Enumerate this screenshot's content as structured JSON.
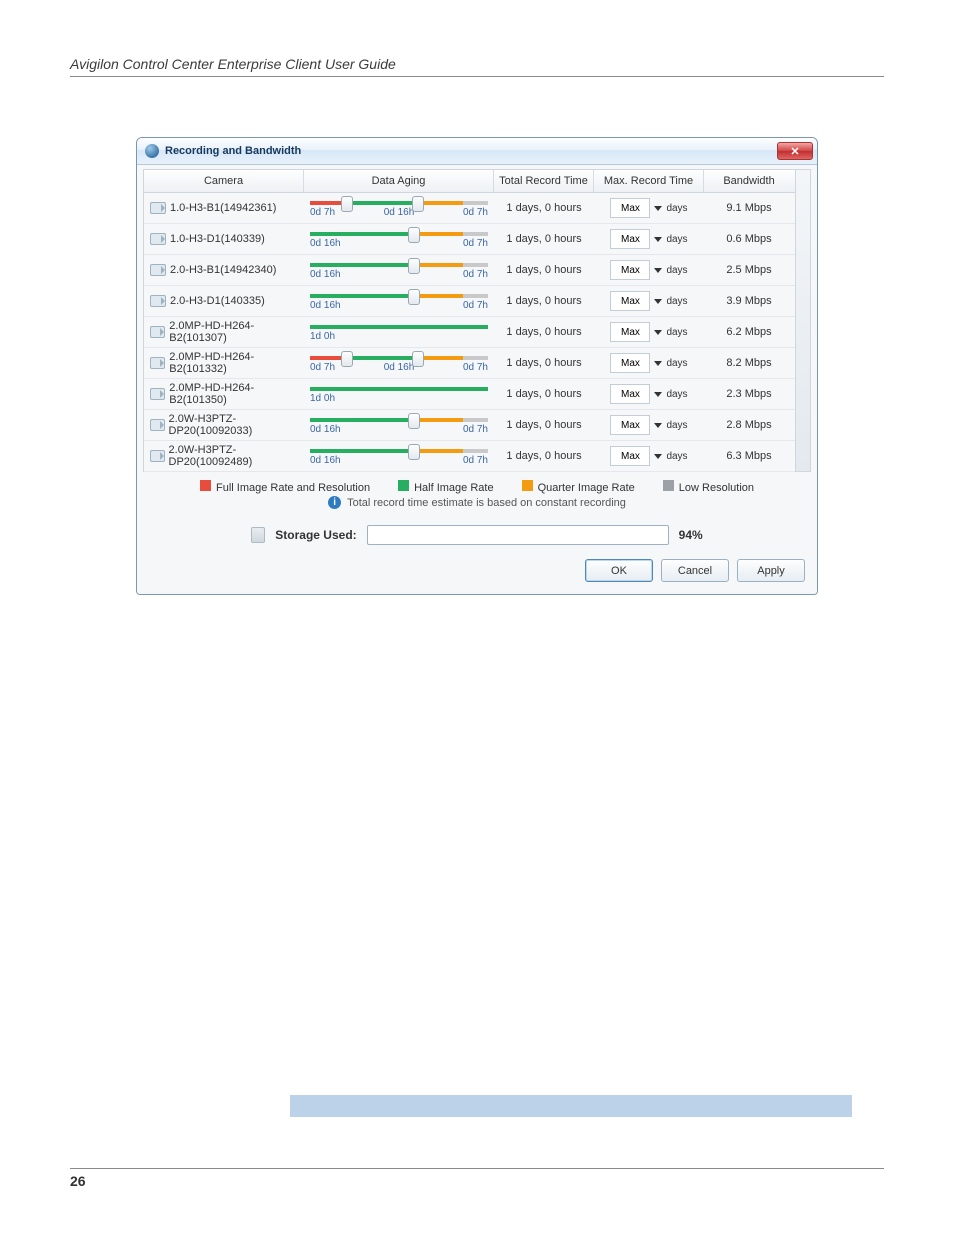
{
  "doc": {
    "running_head": "Avigilon Control Center Enterprise Client User Guide",
    "page_number": "26"
  },
  "dialog": {
    "title": "Recording and Bandwidth",
    "close_glyph": "✕",
    "columns": {
      "camera": "Camera",
      "aging": "Data Aging",
      "total_record": "Total Record Time",
      "max_record": "Max. Record Time",
      "bandwidth": "Bandwidth"
    },
    "rows": [
      {
        "camera": "1.0-H3-B1(14942361)",
        "labels": [
          "0d 7h",
          "0d 16h",
          "0d 7h"
        ],
        "knobs": [
          20,
          60
        ],
        "segs": [
          [
            0,
            20,
            "red"
          ],
          [
            20,
            60,
            "green"
          ],
          [
            60,
            86,
            "orange"
          ],
          [
            86,
            100,
            "grey"
          ]
        ],
        "trt": "1 days, 0 hours",
        "max": "Max",
        "unit": "days",
        "bw": "9.1 Mbps"
      },
      {
        "camera": "1.0-H3-D1(140339)",
        "labels": [
          "0d 16h",
          "",
          "0d 7h"
        ],
        "knobs": [
          58
        ],
        "segs": [
          [
            0,
            58,
            "green"
          ],
          [
            58,
            86,
            "orange"
          ],
          [
            86,
            100,
            "grey"
          ]
        ],
        "trt": "1 days, 0 hours",
        "max": "Max",
        "unit": "days",
        "bw": "0.6 Mbps"
      },
      {
        "camera": "2.0-H3-B1(14942340)",
        "labels": [
          "0d 16h",
          "",
          "0d 7h"
        ],
        "knobs": [
          58
        ],
        "segs": [
          [
            0,
            58,
            "green"
          ],
          [
            58,
            86,
            "orange"
          ],
          [
            86,
            100,
            "grey"
          ]
        ],
        "trt": "1 days, 0 hours",
        "max": "Max",
        "unit": "days",
        "bw": "2.5 Mbps"
      },
      {
        "camera": "2.0-H3-D1(140335)",
        "labels": [
          "0d 16h",
          "",
          "0d 7h"
        ],
        "knobs": [
          58
        ],
        "segs": [
          [
            0,
            58,
            "green"
          ],
          [
            58,
            86,
            "orange"
          ],
          [
            86,
            100,
            "grey"
          ]
        ],
        "trt": "1 days, 0 hours",
        "max": "Max",
        "unit": "days",
        "bw": "3.9 Mbps"
      },
      {
        "camera": "2.0MP-HD-H264-B2(101307)",
        "labels": [
          "1d 0h",
          "",
          ""
        ],
        "knobs": [],
        "segs": [
          [
            0,
            100,
            "green"
          ]
        ],
        "trt": "1 days, 0 hours",
        "max": "Max",
        "unit": "days",
        "bw": "6.2 Mbps"
      },
      {
        "camera": "2.0MP-HD-H264-B2(101332)",
        "labels": [
          "0d 7h",
          "0d 16h",
          "0d 7h"
        ],
        "knobs": [
          20,
          60
        ],
        "segs": [
          [
            0,
            20,
            "red"
          ],
          [
            20,
            60,
            "green"
          ],
          [
            60,
            86,
            "orange"
          ],
          [
            86,
            100,
            "grey"
          ]
        ],
        "trt": "1 days, 0 hours",
        "max": "Max",
        "unit": "days",
        "bw": "8.2 Mbps"
      },
      {
        "camera": "2.0MP-HD-H264-B2(101350)",
        "labels": [
          "1d 0h",
          "",
          ""
        ],
        "knobs": [],
        "segs": [
          [
            0,
            100,
            "green"
          ]
        ],
        "trt": "1 days, 0 hours",
        "max": "Max",
        "unit": "days",
        "bw": "2.3 Mbps"
      },
      {
        "camera": "2.0W-H3PTZ-DP20(10092033)",
        "labels": [
          "0d 16h",
          "",
          "0d 7h"
        ],
        "knobs": [
          58
        ],
        "segs": [
          [
            0,
            58,
            "green"
          ],
          [
            58,
            86,
            "orange"
          ],
          [
            86,
            100,
            "grey"
          ]
        ],
        "trt": "1 days, 0 hours",
        "max": "Max",
        "unit": "days",
        "bw": "2.8 Mbps"
      },
      {
        "camera": "2.0W-H3PTZ-DP20(10092489)",
        "labels": [
          "0d 16h",
          "",
          "0d 7h"
        ],
        "knobs": [
          58
        ],
        "segs": [
          [
            0,
            58,
            "green"
          ],
          [
            58,
            86,
            "orange"
          ],
          [
            86,
            100,
            "grey"
          ]
        ],
        "trt": "1 days, 0 hours",
        "max": "Max",
        "unit": "days",
        "bw": "6.3 Mbps"
      }
    ],
    "legend": [
      {
        "color": "#e84c3d",
        "label": "Full Image Rate and Resolution"
      },
      {
        "color": "#27ae60",
        "label": "Half Image Rate"
      },
      {
        "color": "#f39c12",
        "label": "Quarter Image Rate"
      },
      {
        "color": "#9aa1a7",
        "label": "Low Resolution"
      }
    ],
    "note": "Total record time estimate is based on constant recording",
    "storage": {
      "label": "Storage Used:",
      "percent_label": "94%",
      "percent": 94
    },
    "buttons": {
      "ok": "OK",
      "cancel": "Cancel",
      "apply": "Apply"
    }
  }
}
